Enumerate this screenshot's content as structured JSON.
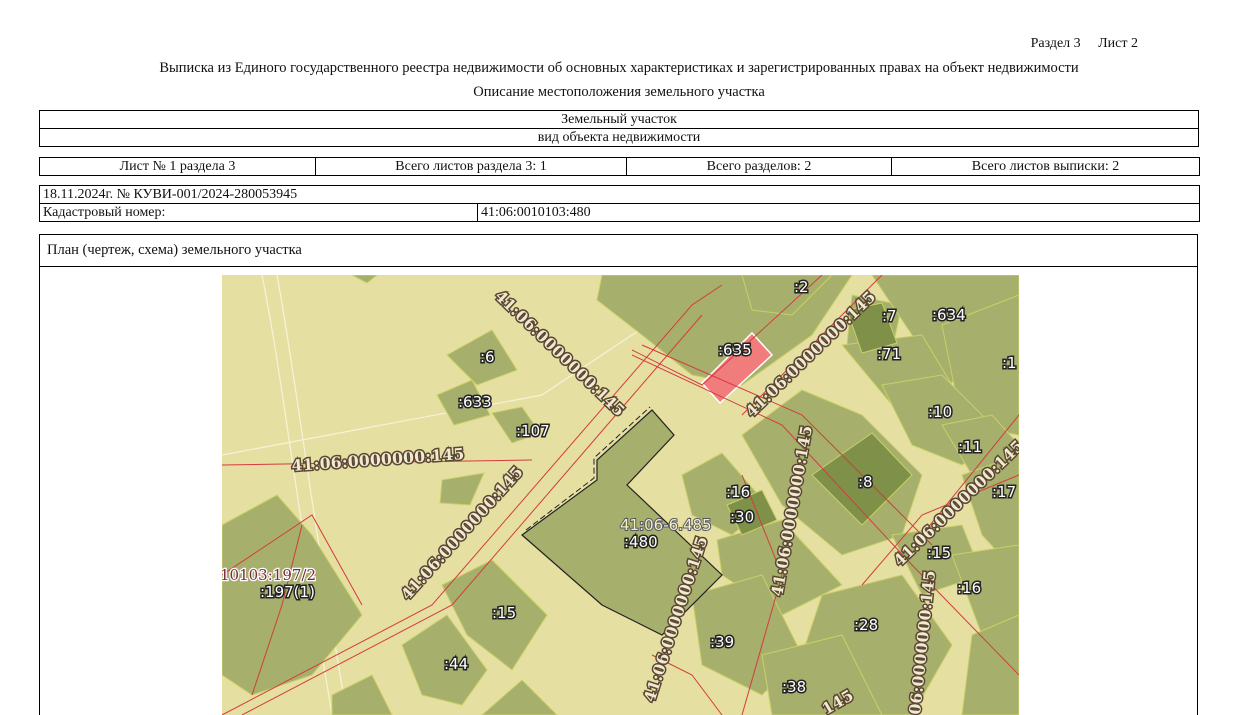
{
  "header": {
    "section": "Раздел 3",
    "sheet": "Лист 2",
    "title": "Выписка из Единого государственного реестра недвижимости об основных характеристиках и зарегистрированных правах на объект недвижимости",
    "subtitle": "Описание местоположения земельного участка"
  },
  "object": {
    "type_value": "Земельный участок",
    "type_caption": "вид объекта недвижимости"
  },
  "sheets": {
    "sheet_no": "Лист № 1 раздела 3",
    "total_section_sheets": "Всего листов раздела 3: 1",
    "total_sections": "Всего разделов: 2",
    "total_extract_sheets": "Всего листов выписки: 2"
  },
  "record": {
    "date_number": "18.11.2024г. № КУВИ-001/2024-280053945",
    "cadastral_label": "Кадастровый номер:",
    "cadastral_value": "41:06:0010103:480"
  },
  "plan": {
    "heading": "План (чертеж, схема) земельного участка",
    "labels": {
      "p2": ":2",
      "p635": ":635",
      "p7": ":7",
      "p634": ":634",
      "p1": ":1",
      "p6": ":6",
      "p71": ":71",
      "p633": ":633",
      "p107": ":107",
      "p10": ":10",
      "p11": ":11",
      "p8": ":8",
      "p17": ":17",
      "p16a": ":16",
      "p30": ":30",
      "p480": ":480",
      "p15a": ":15",
      "p16b": ":16",
      "p197": ":197(1)",
      "p15b": ":15",
      "p28": ":28",
      "p39": ":39",
      "p44": ":44",
      "p38": ":38",
      "zone": "41:06-6.485",
      "neighbor": "10103:197/2",
      "road": "41:06:0000000:145",
      "road_partial": "145",
      "road_partial2": "06:0000000:145"
    },
    "colors": {
      "background": "#e6dfa2",
      "parcel": "#a6b06c",
      "parcel_dark": "#7f9049",
      "target_highlight": "#f07c7c",
      "boundary": "#d43c3c"
    }
  }
}
